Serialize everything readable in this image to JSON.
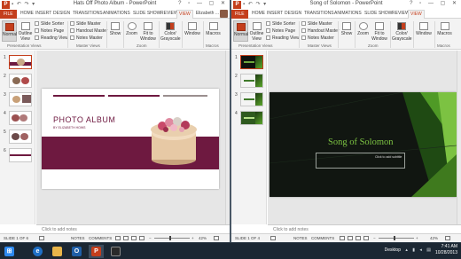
{
  "left": {
    "title": "Hats Off Photo Album - PowerPoint",
    "user": "Elizabeth ...",
    "tabs": [
      "FILE",
      "HOME",
      "INSERT",
      "DESIGN",
      "TRANSITIONS",
      "ANIMATIONS",
      "SLIDE SHOW",
      "REVIEW",
      "VIEW"
    ],
    "ribbon": {
      "normal": "Normal",
      "outline": "Outline View",
      "slide_sorter": "Slide Sorter",
      "notes_page": "Notes Page",
      "reading_view": "Reading View",
      "slide_master": "Slide Master",
      "handout_master": "Handout Master",
      "notes_master": "Notes Master",
      "show": "Show",
      "zoom": "Zoom",
      "fit_window": "Fit to Window",
      "color": "Color/ Grayscale",
      "window": "Window",
      "macros": "Macros",
      "g_presentation": "Presentation Views",
      "g_master": "Master Views",
      "g_zoom": "Zoom",
      "g_macros": "Macros"
    },
    "thumb_numbers": [
      "1",
      "2",
      "3",
      "4",
      "5",
      "6"
    ],
    "slide": {
      "title": "PHOTO ALBUM",
      "subtitle": "BY ELIZABETH HOWS"
    },
    "notes": "Click to add notes",
    "status": {
      "slide": "SLIDE 1 OF 6",
      "notes": "NOTES",
      "comments": "COMMENTS",
      "zoom": "42%"
    }
  },
  "right": {
    "title": "Song of Solomon - PowerPoint",
    "tabs": [
      "FILE",
      "HOME",
      "INSERT",
      "DESIGN",
      "TRANSITIONS",
      "ANIMATIONS",
      "SLIDE SHOW",
      "REVIEW",
      "VIEW"
    ],
    "ribbon": {
      "normal": "Normal",
      "outline": "Outline View",
      "slide_sorter": "Slide Sorter",
      "notes_page": "Notes Page",
      "reading_view": "Reading View",
      "slide_master": "Slide Master",
      "handout_master": "Handout Master",
      "notes_master": "Notes Master",
      "show": "Show",
      "zoom": "Zoom",
      "fit_window": "Fit to Window",
      "color": "Color/ Grayscale",
      "window": "Window",
      "macros": "Macros",
      "g_presentation": "Presentation Views",
      "g_master": "Master Views",
      "g_zoom": "Zoom",
      "g_macros": "Macros"
    },
    "thumb_numbers": [
      "1",
      "2",
      "3",
      "4"
    ],
    "slide": {
      "title": "Song of Solomon",
      "subtitle": "Click to add subtitle"
    },
    "notes": "Click to add notes",
    "status": {
      "slide": "SLIDE 1 OF 4",
      "notes": "NOTES",
      "comments": "COMMENTS",
      "zoom": "42%"
    }
  },
  "taskbar": {
    "desktop_label": "Desktop",
    "time": "7:41 AM",
    "date": "10/28/2013"
  },
  "colors": {
    "accent": "#c43e1c",
    "album_band": "#6e1940",
    "solomon_green": "#7cc242"
  }
}
